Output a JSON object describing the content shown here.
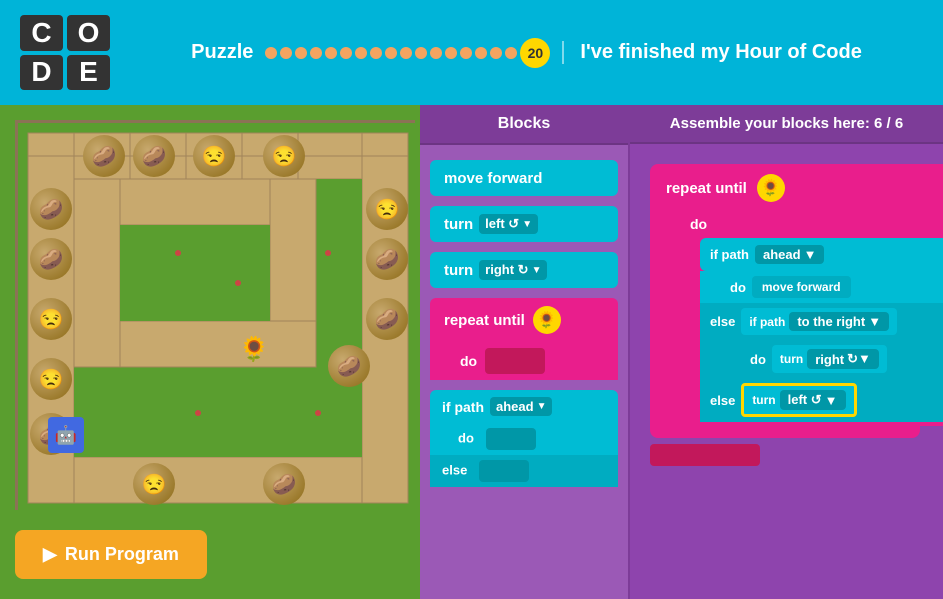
{
  "header": {
    "logo": {
      "cells": [
        "C",
        "O",
        "D",
        "E"
      ]
    },
    "puzzle_label": "Puzzle",
    "puzzle_number": "20",
    "finished_text": "I've finished my Hour of Code",
    "dots_count": 18
  },
  "blocks_panel": {
    "title": "Blocks",
    "blocks": [
      {
        "id": "move-forward",
        "label": "move forward",
        "type": "cyan"
      },
      {
        "id": "turn-left",
        "label": "turn",
        "dropdown": "left",
        "type": "cyan"
      },
      {
        "id": "turn-right",
        "label": "turn",
        "dropdown": "right",
        "type": "cyan"
      },
      {
        "id": "repeat-until",
        "label": "repeat until",
        "type": "pink"
      },
      {
        "id": "do",
        "label": "do",
        "type": "pink"
      },
      {
        "id": "if-path",
        "label": "if path",
        "dropdown": "ahead",
        "type": "cyan"
      },
      {
        "id": "do2",
        "label": "do",
        "type": "cyan"
      },
      {
        "id": "else",
        "label": "else",
        "type": "cyan"
      }
    ]
  },
  "assemble_panel": {
    "title": "Assemble your blocks here: 6 / 6",
    "repeat_until": "repeat until",
    "do": "do",
    "if_path": "if path",
    "ahead_dropdown": "ahead",
    "move_forward": "move forward",
    "else": "else",
    "to_the_right": "to the right",
    "turn_right": "turn right",
    "turn_left": "turn left",
    "right_dropdown": "right",
    "left_dropdown": "left ↺"
  },
  "run_button": {
    "label": "Run Program"
  },
  "icons": {
    "play": "▶",
    "sunflower": "🌻",
    "arrow_down": "▼",
    "rotate": "↺"
  }
}
